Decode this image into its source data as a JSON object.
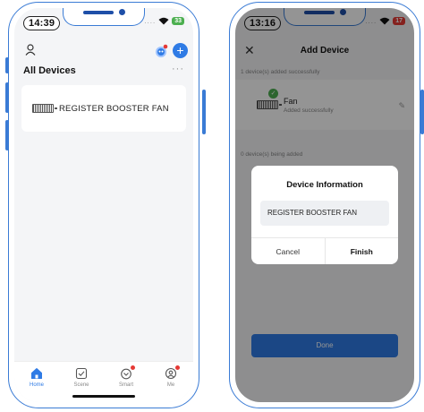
{
  "left": {
    "status": {
      "time": "14:39",
      "battery": "33"
    },
    "header": {
      "title": "All Devices",
      "more": "···",
      "add": "+"
    },
    "devices": [
      {
        "name": "REGISTER BOOSTER FAN"
      }
    ],
    "tabs": [
      {
        "label": "Home",
        "icon": "home-icon"
      },
      {
        "label": "Scene",
        "icon": "scene-icon"
      },
      {
        "label": "Smart",
        "icon": "smart-icon"
      },
      {
        "label": "Me",
        "icon": "me-icon"
      }
    ]
  },
  "right": {
    "status": {
      "time": "13:16",
      "battery": "17"
    },
    "header": {
      "title": "Add Device",
      "back": "✕"
    },
    "added_text": "1 device(s) added successfully",
    "device": {
      "name": "Fan",
      "status": "Added successfully"
    },
    "adding_text": "0 device(s) being added",
    "done_label": "Done",
    "dialog": {
      "title": "Device Information",
      "value": "REGISTER BOOSTER FAN",
      "cancel": "Cancel",
      "finish": "Finish"
    }
  },
  "colors": {
    "accent": "#2f7be5",
    "frame": "#3a7bd5",
    "success": "#4caf50",
    "badge": "#e53935"
  }
}
